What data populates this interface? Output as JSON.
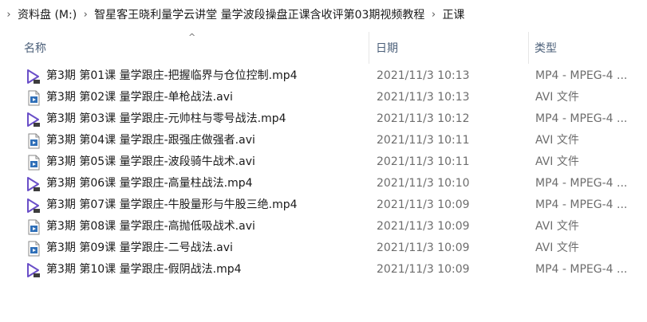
{
  "breadcrumb": {
    "segments": [
      "资料盘 (M:)",
      "智星客王晓利量学云讲堂 量学波段操盘正课含收评第03期视频教程",
      "正课"
    ]
  },
  "columns": {
    "name": "名称",
    "date": "日期",
    "type": "类型"
  },
  "files": [
    {
      "name": "第3期 第01课 量学跟庄-把握临界与仓位控制.mp4",
      "date": "2021/11/3 10:13",
      "type": "MP4 - MPEG-4 ...",
      "icon": "video-file-icon"
    },
    {
      "name": "第3期 第02课 量学跟庄-单枪战法.avi",
      "date": "2021/11/3 10:13",
      "type": "AVI 文件",
      "icon": "avi-file-icon"
    },
    {
      "name": "第3期 第03课 量学跟庄-元帅柱与零号战法.mp4",
      "date": "2021/11/3 10:12",
      "type": "MP4 - MPEG-4 ...",
      "icon": "video-file-icon"
    },
    {
      "name": "第3期 第04课 量学跟庄-跟强庄做强者.avi",
      "date": "2021/11/3 10:11",
      "type": "AVI 文件",
      "icon": "avi-file-icon"
    },
    {
      "name": "第3期 第05课 量学跟庄-波段骑牛战术.avi",
      "date": "2021/11/3 10:11",
      "type": "AVI 文件",
      "icon": "avi-file-icon"
    },
    {
      "name": "第3期 第06课 量学跟庄-高量柱战法.mp4",
      "date": "2021/11/3 10:10",
      "type": "MP4 - MPEG-4 ...",
      "icon": "video-file-icon"
    },
    {
      "name": "第3期 第07课 量学跟庄-牛股量形与牛股三绝.mp4",
      "date": "2021/11/3 10:09",
      "type": "MP4 - MPEG-4 ...",
      "icon": "video-file-icon"
    },
    {
      "name": "第3期 第08课 量学跟庄-高抛低吸战术.avi",
      "date": "2021/11/3 10:09",
      "type": "AVI 文件",
      "icon": "avi-file-icon"
    },
    {
      "name": "第3期 第09课 量学跟庄-二号战法.avi",
      "date": "2021/11/3 10:09",
      "type": "AVI 文件",
      "icon": "avi-file-icon"
    },
    {
      "name": "第3期 第10课 量学跟庄-假阴战法.mp4",
      "date": "2021/11/3 10:09",
      "type": "MP4 - MPEG-4 ...",
      "icon": "video-file-icon"
    }
  ]
}
